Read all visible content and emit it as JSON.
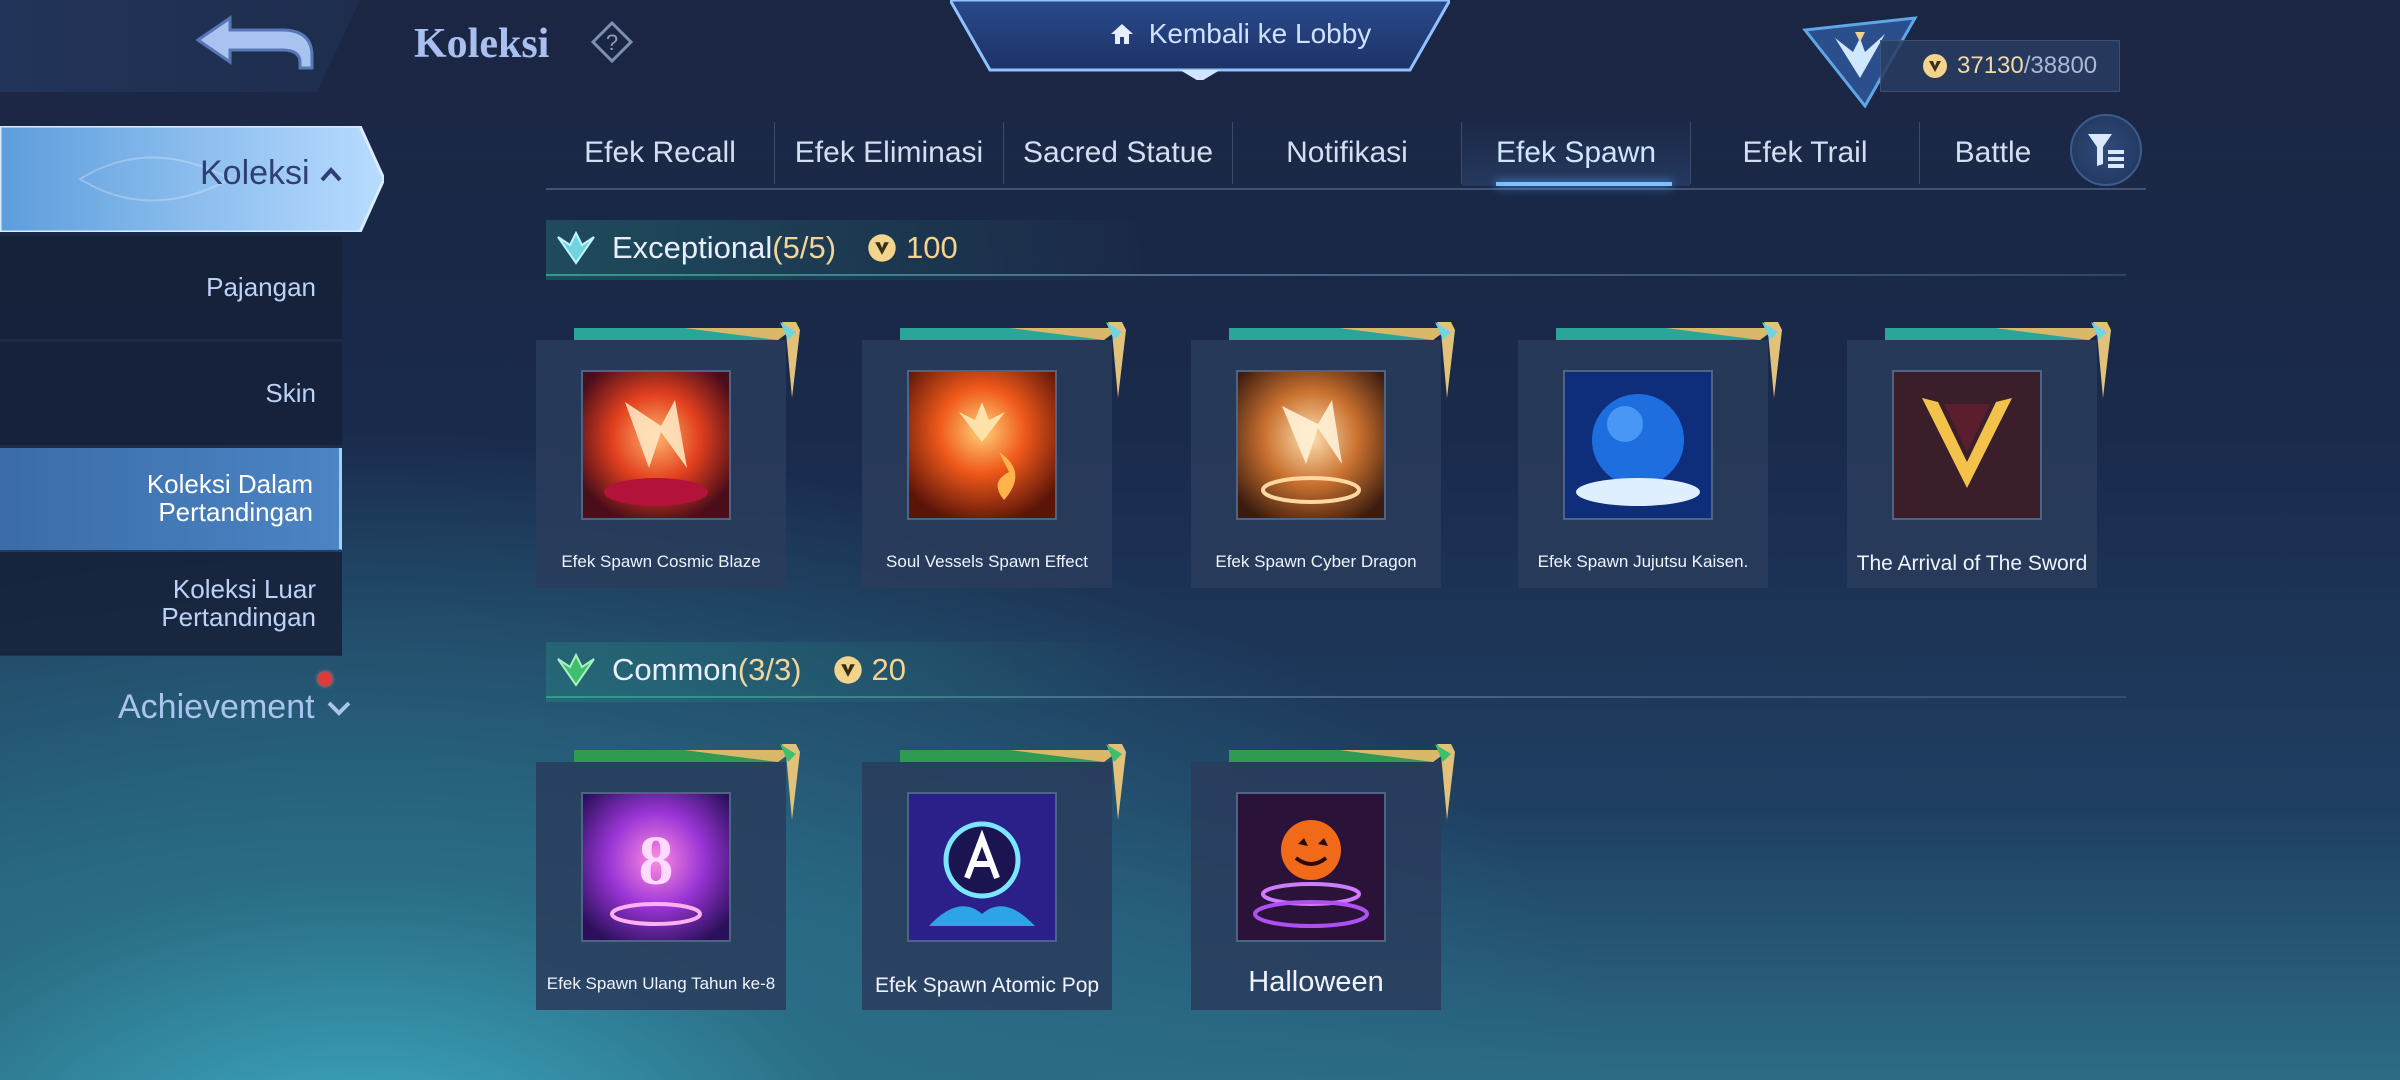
{
  "header": {
    "title": "Koleksi",
    "lobby_button": "Kembali ke Lobby",
    "points_current": "37130",
    "points_max": "/38800"
  },
  "sidebar": {
    "active": "Koleksi",
    "items": [
      {
        "label": "Pajangan"
      },
      {
        "label": "Skin"
      },
      {
        "label": "Koleksi Dalam Pertandingan"
      },
      {
        "label": "Koleksi Luar Pertandingan"
      }
    ],
    "achievement": "Achievement"
  },
  "tabs": [
    "Efek Recall",
    "Efek Eliminasi",
    "Sacred Statue",
    "Notifikasi",
    "Efek Spawn",
    "Efek Trail",
    "Battle"
  ],
  "active_tab": "Efek Spawn",
  "sections": [
    {
      "title": "Exceptional",
      "count": "(5/5)",
      "points": "100",
      "items": [
        {
          "name": "Efek Spawn Cosmic Blaze"
        },
        {
          "name": "Soul Vessels Spawn Effect"
        },
        {
          "name": "Efek Spawn Cyber Dragon"
        },
        {
          "name": "Efek Spawn Jujutsu Kaisen."
        },
        {
          "name": "The Arrival of The Sword"
        }
      ]
    },
    {
      "title": "Common",
      "count": "(3/3)",
      "points": "20",
      "items": [
        {
          "name": "Efek Spawn Ulang Tahun ke-8"
        },
        {
          "name": "Efek Spawn Atomic Pop"
        },
        {
          "name": "Halloween"
        }
      ]
    }
  ],
  "colors": {
    "accent_teal": "#2e9c8b",
    "gold": "#f4d48f",
    "selected_blue": "#4c84c4"
  }
}
